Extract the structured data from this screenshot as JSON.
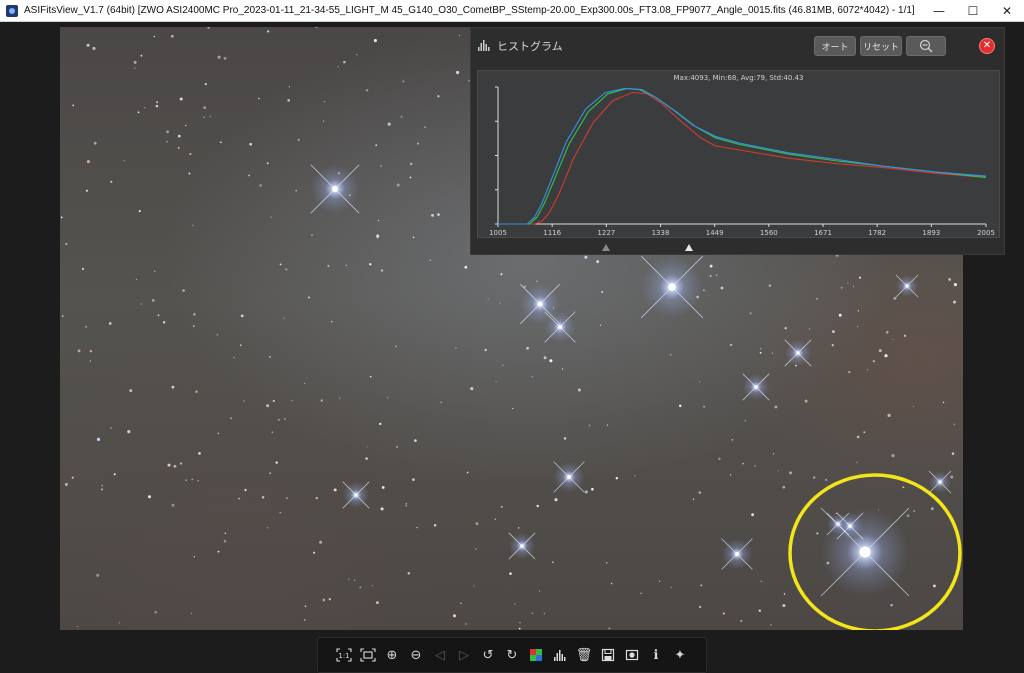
{
  "window": {
    "title": "ASIFitsView_V1.7 (64bit) [ZWO ASI2400MC Pro_2023-01-11_21-34-55_LIGHT_M 45_G140_O30_CometBP_SStemp-20.00_Exp300.00s_FT3.08_FP9077_Angle_0015.fits (46.81MB, 6072*4042) - 1/1]",
    "minimize_glyph": "—",
    "maximize_glyph": "☐",
    "close_glyph": "✕"
  },
  "histogram": {
    "title": "ヒストグラム",
    "auto_label": "オート",
    "reset_label": "リセット",
    "zoom_icon": "zoom-out-icon",
    "close_glyph": "✕",
    "stats": "Max:4093, Min:68, Avg:79, Std:40.43",
    "colors": {
      "red": "#d33a2c",
      "green": "#2ec44a",
      "blue": "#3a8ee6"
    }
  },
  "chart_data": {
    "type": "line",
    "title": "",
    "xlabel": "",
    "ylabel": "",
    "x_ticks": [
      1005,
      1116,
      1227,
      1338,
      1449,
      1560,
      1671,
      1782,
      1893,
      2005
    ],
    "xlim": [
      1005,
      2005
    ],
    "ylim": [
      0,
      1
    ],
    "grid": false,
    "series": [
      {
        "color": "#d33a2c",
        "x": [
          1005,
          1080,
          1095,
          1110,
          1130,
          1160,
          1200,
          1240,
          1280,
          1310,
          1340,
          1380,
          1420,
          1450,
          1500,
          1600,
          1700,
          1800,
          1900,
          2005
        ],
        "y": [
          0.0,
          0.0,
          0.02,
          0.08,
          0.22,
          0.48,
          0.74,
          0.9,
          0.96,
          0.95,
          0.88,
          0.75,
          0.63,
          0.57,
          0.54,
          0.48,
          0.44,
          0.41,
          0.37,
          0.34
        ]
      },
      {
        "color": "#2ec44a",
        "x": [
          1005,
          1070,
          1085,
          1100,
          1120,
          1150,
          1190,
          1230,
          1270,
          1300,
          1330,
          1370,
          1410,
          1450,
          1500,
          1600,
          1700,
          1800,
          1900,
          2005
        ],
        "y": [
          0.0,
          0.0,
          0.05,
          0.15,
          0.32,
          0.58,
          0.82,
          0.95,
          0.99,
          0.98,
          0.92,
          0.82,
          0.71,
          0.63,
          0.58,
          0.51,
          0.46,
          0.42,
          0.38,
          0.34
        ]
      },
      {
        "color": "#3a8ee6",
        "x": [
          1005,
          1065,
          1080,
          1095,
          1115,
          1145,
          1185,
          1225,
          1265,
          1295,
          1325,
          1365,
          1405,
          1450,
          1500,
          1600,
          1700,
          1800,
          1900,
          2005
        ],
        "y": [
          0.0,
          0.0,
          0.05,
          0.15,
          0.33,
          0.6,
          0.84,
          0.96,
          0.99,
          0.98,
          0.93,
          0.83,
          0.72,
          0.64,
          0.59,
          0.52,
          0.47,
          0.42,
          0.38,
          0.35
        ]
      }
    ]
  },
  "image": {
    "annotation_circle_color": "#f2e61a"
  },
  "toolbar": {
    "buttons": [
      {
        "name": "actual-size-icon",
        "glyph": "1:1",
        "enabled": true
      },
      {
        "name": "fit-to-window-icon",
        "glyph": "⛶",
        "enabled": true
      },
      {
        "name": "zoom-in-icon",
        "glyph": "⊕",
        "enabled": true
      },
      {
        "name": "zoom-out-icon",
        "glyph": "⊖",
        "enabled": true
      },
      {
        "name": "previous-icon",
        "glyph": "◁",
        "enabled": false
      },
      {
        "name": "next-icon",
        "glyph": "▷",
        "enabled": false
      },
      {
        "name": "rotate-left-icon",
        "glyph": "↺",
        "enabled": true
      },
      {
        "name": "rotate-right-icon",
        "glyph": "↻",
        "enabled": true
      },
      {
        "name": "color-debayer-icon",
        "glyph": "",
        "enabled": true
      },
      {
        "name": "histogram-icon",
        "glyph": "",
        "enabled": true
      },
      {
        "name": "delete-icon",
        "glyph": "🗑",
        "enabled": true
      },
      {
        "name": "save-icon",
        "glyph": "",
        "enabled": true
      },
      {
        "name": "stretch-icon",
        "glyph": "",
        "enabled": true
      },
      {
        "name": "info-icon",
        "glyph": "ℹ",
        "enabled": true
      },
      {
        "name": "star-detect-icon",
        "glyph": "✦",
        "enabled": true
      }
    ]
  }
}
